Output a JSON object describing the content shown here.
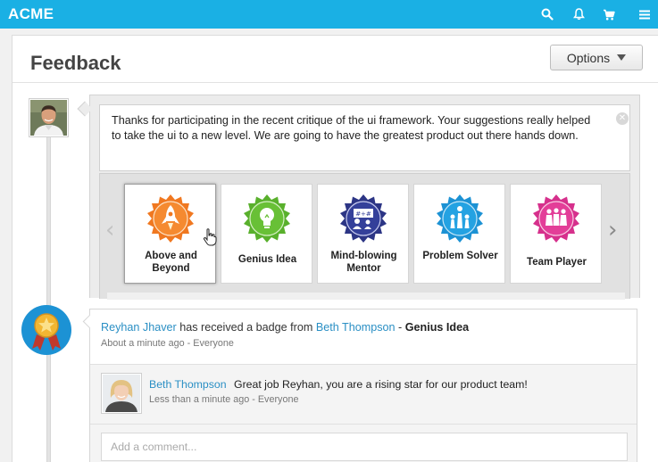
{
  "app": {
    "brand": "ACME"
  },
  "topbar": {
    "icons": [
      "search-icon",
      "bell-icon",
      "cart-icon",
      "menu-icon"
    ]
  },
  "colors": {
    "topbar": "#1ab0e4",
    "link": "#2a8fc4"
  },
  "page": {
    "title": "Feedback",
    "options_label": "Options"
  },
  "compose": {
    "message": "Thanks for participating in the recent critique of the ui framework. Your suggestions really helped to take the ui to a new level. We are going to have the greatest product out there hands down."
  },
  "badges": [
    {
      "label": "Above and Beyond",
      "color": "#f07820",
      "icon": "rocket-icon",
      "selected": true
    },
    {
      "label": "Genius Idea",
      "color": "#59b02c",
      "icon": "lightbulb-icon",
      "selected": false
    },
    {
      "label": "Mind-blowing Mentor",
      "color": "#2c3585",
      "icon": "mentor-icon",
      "selected": false
    },
    {
      "label": "Problem Solver",
      "color": "#1c92d4",
      "icon": "chess-icon",
      "selected": false
    },
    {
      "label": "Team Player",
      "color": "#d6308c",
      "icon": "team-icon",
      "selected": false
    }
  ],
  "activity": {
    "recipient": "Reyhan Jhaver",
    "action_text": "has received a badge from",
    "sender": "Beth Thompson",
    "separator": "-",
    "badge": "Genius Idea",
    "time": "About a minute ago",
    "audience": "Everyone",
    "meta_separator": "-",
    "comment": {
      "author": "Beth Thompson",
      "text": "Great job Reyhan, you are a rising star for our product team!",
      "time": "Less than a minute ago",
      "audience": "Everyone"
    },
    "add_comment_placeholder": "Add a comment..."
  }
}
